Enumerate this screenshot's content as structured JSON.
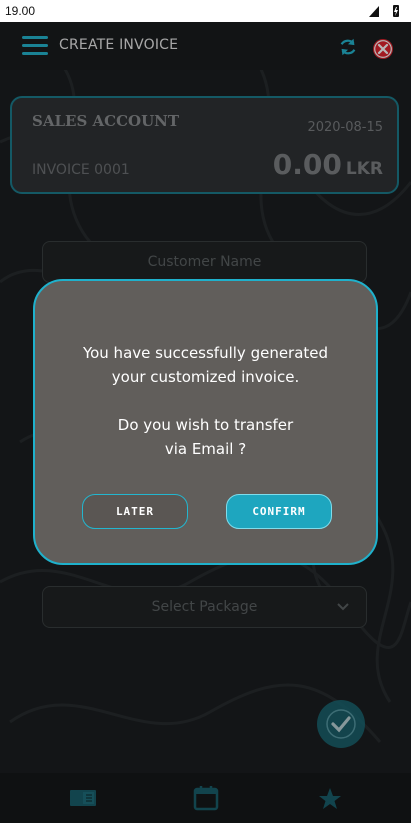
{
  "status_bar": {
    "time": "19.00"
  },
  "app_bar": {
    "title": "CREATE INVOICE"
  },
  "account": {
    "name": "SALES ACCOUNT",
    "date": "2020-08-15",
    "invoice": "INVOICE 0001",
    "amount": "0.00",
    "currency": "LKR"
  },
  "form": {
    "customer_placeholder": "Customer Name",
    "package_placeholder": "Select Package"
  },
  "dialog": {
    "message_line1": "You have successfully generated",
    "message_line2": "your customized invoice.",
    "question_line1": "Do you wish to transfer",
    "question_line2": "via Email ?",
    "later_label": "LATER",
    "confirm_label": "CONFIRM"
  },
  "colors": {
    "accent": "#25b6cf",
    "dialog_bg": "#615e5b",
    "close": "#e1252f"
  },
  "icons": {
    "menu": "hamburger-icon",
    "refresh": "refresh-icon",
    "close": "close-icon",
    "check": "check-icon",
    "nav": [
      "book-icon",
      "calendar-icon",
      "star-icon"
    ]
  }
}
